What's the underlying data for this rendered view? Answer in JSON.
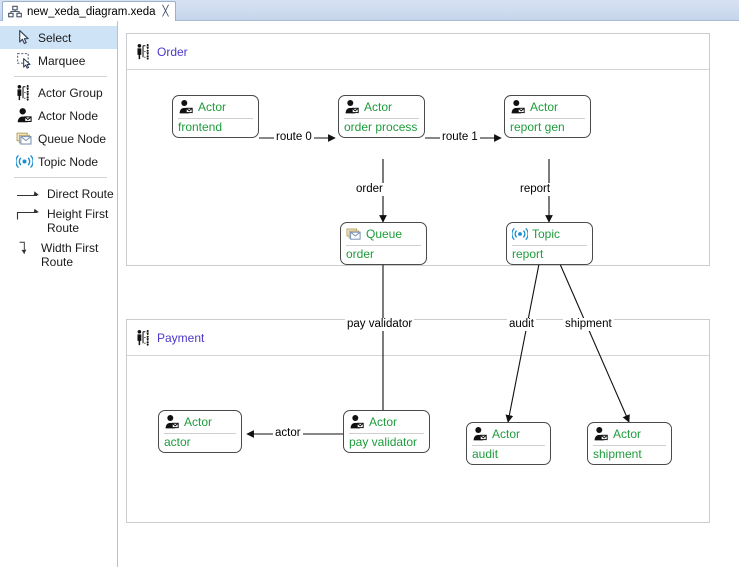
{
  "window": {
    "tab": {
      "title": "new_xeda_diagram.xeda",
      "icon": "diagram-icon",
      "close_icon": "╳"
    }
  },
  "palette": {
    "groups": [
      {
        "items": [
          {
            "label": "Select",
            "icon": "cursor-arrow-icon",
            "selected": true
          },
          {
            "label": "Marquee",
            "icon": "marquee-select-icon",
            "selected": false
          }
        ]
      },
      {
        "items": [
          {
            "label": "Actor Group",
            "icon": "actor-group-icon",
            "selected": false
          },
          {
            "label": "Actor Node",
            "icon": "actor-node-icon",
            "selected": false
          },
          {
            "label": "Queue Node",
            "icon": "queue-node-icon",
            "selected": false
          },
          {
            "label": "Topic Node",
            "icon": "topic-node-icon",
            "selected": false
          }
        ]
      },
      {
        "items": [
          {
            "label": "Direct Route",
            "icon": "direct-route-icon",
            "selected": false
          },
          {
            "label": "Height First\nRoute",
            "icon": "height-first-route-icon",
            "selected": false
          },
          {
            "label": "Width First\nRoute",
            "icon": "width-first-route-icon",
            "selected": false
          }
        ]
      }
    ]
  },
  "diagram": {
    "groups": [
      {
        "id": "order",
        "title": "Order",
        "icon": "actor-group-icon"
      },
      {
        "id": "payment",
        "title": "Payment",
        "icon": "actor-group-icon"
      }
    ],
    "nodes": [
      {
        "id": "frontend",
        "type": "Actor",
        "name": "frontend",
        "icon": "actor-node-icon"
      },
      {
        "id": "order_process",
        "type": "Actor",
        "name": "order process",
        "icon": "actor-node-icon"
      },
      {
        "id": "report_gen",
        "type": "Actor",
        "name": "report gen",
        "icon": "actor-node-icon"
      },
      {
        "id": "queue_order",
        "type": "Queue",
        "name": "order",
        "icon": "queue-node-icon"
      },
      {
        "id": "topic_report",
        "type": "Topic",
        "name": "report",
        "icon": "topic-node-icon"
      },
      {
        "id": "actor",
        "type": "Actor",
        "name": "actor",
        "icon": "actor-node-icon"
      },
      {
        "id": "pay_validator",
        "type": "Actor",
        "name": "pay validator",
        "icon": "actor-node-icon"
      },
      {
        "id": "audit",
        "type": "Actor",
        "name": "audit",
        "icon": "actor-node-icon"
      },
      {
        "id": "shipment",
        "type": "Actor",
        "name": "shipment",
        "icon": "actor-node-icon"
      }
    ],
    "edges": [
      {
        "id": "route0",
        "label": "route 0",
        "from": "frontend",
        "to": "order_process"
      },
      {
        "id": "route1",
        "label": "route 1",
        "from": "order_process",
        "to": "report_gen"
      },
      {
        "id": "order_edge",
        "label": "order",
        "from": "order_process",
        "to": "queue_order"
      },
      {
        "id": "report_edge",
        "label": "report",
        "from": "report_gen",
        "to": "topic_report"
      },
      {
        "id": "payval_edge",
        "label": "pay validator",
        "from": "queue_order",
        "to": "pay_validator"
      },
      {
        "id": "audit_edge",
        "label": "audit",
        "from": "topic_report",
        "to": "audit"
      },
      {
        "id": "shipment_edge",
        "label": "shipment",
        "from": "topic_report",
        "to": "shipment"
      },
      {
        "id": "actor_edge",
        "label": "actor",
        "from": "pay_validator",
        "to": "actor"
      }
    ]
  },
  "colors": {
    "node_text": "#1e9c3c",
    "group_title": "#4b37c8",
    "tab_bar": "#cfdcef",
    "selection": "#cfe3f7"
  }
}
